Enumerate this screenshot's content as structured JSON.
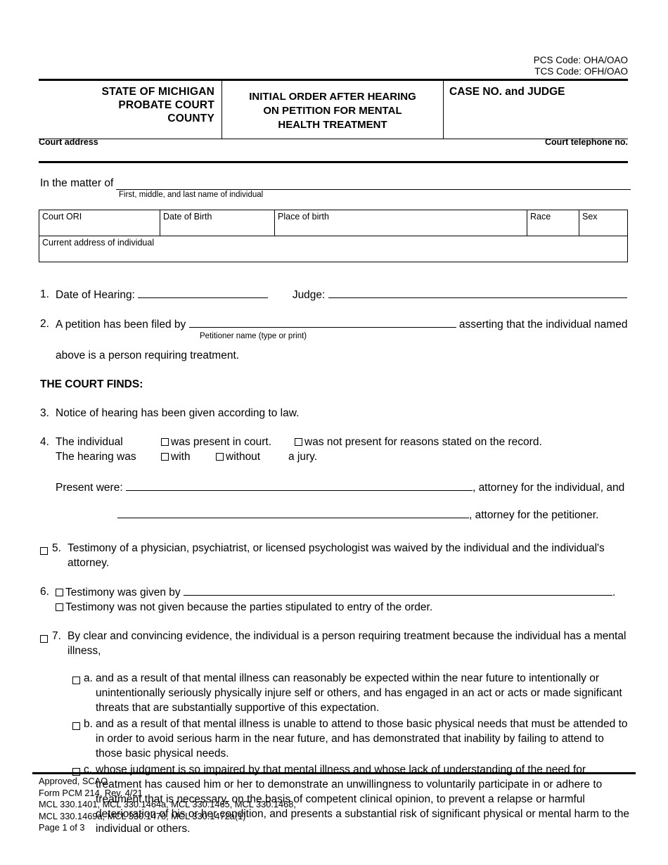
{
  "codes": {
    "pcs": "PCS Code: OHA/OAO",
    "tcs": "TCS Code: OFH/OAO"
  },
  "caption": {
    "state_line1": "STATE OF MICHIGAN",
    "state_line2": "PROBATE COURT",
    "state_line3": "COUNTY",
    "title_line1": "INITIAL ORDER AFTER HEARING",
    "title_line2": "ON PETITION FOR MENTAL",
    "title_line3": "HEALTH TREATMENT",
    "case_no_label": "CASE NO. and JUDGE",
    "court_address_label": "Court address",
    "court_phone_label": "Court telephone no."
  },
  "matter": {
    "label": "In the matter of",
    "sublabel": "First, middle, and last name of individual"
  },
  "info_table": {
    "headers": [
      "Court ORI",
      "Date of Birth",
      "Place of birth",
      "Race",
      "Sex"
    ],
    "address_label": "Current address of individual"
  },
  "items": {
    "item1": {
      "num": "1.",
      "date_label": "Date of Hearing:",
      "judge_label": "Judge:"
    },
    "item2": {
      "num": "2.",
      "text_before": "A petition has been filed by",
      "sublabel": "Petitioner name (type or print)",
      "text_after": "asserting that the individual named",
      "line2": "above is a person requiring treatment."
    },
    "court_finds_heading": "THE COURT FINDS:",
    "item3": {
      "num": "3.",
      "text": "Notice of hearing has been given according to law."
    },
    "item4": {
      "num": "4.",
      "label_individual": "The individual",
      "opt_present": "was present in court.",
      "opt_not_present": "was not present for reasons stated on the record.",
      "label_hearing": "The hearing was",
      "opt_with": "with",
      "opt_without": "without",
      "opt_jury": "a jury.",
      "present_were_label": "Present were:",
      "attorney_individual": ", attorney for the individual, and",
      "attorney_petitioner": ", attorney for the petitioner."
    },
    "item5": {
      "num": "5.",
      "text": "Testimony of a physician, psychiatrist, or licensed psychologist was waived by the individual and the individual's attorney."
    },
    "item6": {
      "num": "6.",
      "opt_given": "Testimony was given by",
      "period": ".",
      "opt_not_given": "Testimony was not given because the parties stipulated to entry of the order."
    },
    "item7": {
      "num": "7.",
      "text": "By clear and convincing evidence, the individual is a person requiring treatment because the individual has a mental illness,",
      "subitems": [
        {
          "letter": "a.",
          "text": "and as a result of that mental illness can reasonably be expected within the near future to intentionally or unintentionally seriously physically injure self or others, and has engaged in an act or acts or made significant threats that are substantially supportive of this expectation."
        },
        {
          "letter": "b.",
          "text": "and as a result of that mental illness is unable to attend to those basic physical needs that must be attended to in order to avoid serious harm in the near future, and has demonstrated that inability by failing to attend to those basic physical needs."
        },
        {
          "letter": "c.",
          "text": "whose judgment is so impaired by that mental illness and whose lack of understanding of the need for treatment has caused him or her to demonstrate an unwillingness to voluntarily participate in or adhere to treatment that is necessary, on the basis of competent clinical opinion, to prevent a relapse or harmful deterioration of his or her condition, and presents a substantial risk of significant physical or mental harm to the individual or others."
        }
      ]
    }
  },
  "footer": {
    "line1": "Approved, SCAO",
    "line2": "Form PCM 214, Rev. 4/21",
    "line3": "MCL 330.1401, MCL 330.1464a, MCL 330.1465, MCL 330.1468,",
    "line4": "MCL 330.1469a, MCL 330.1470, MCL 330.1472a(1)",
    "line5": "Page 1 of 3"
  }
}
